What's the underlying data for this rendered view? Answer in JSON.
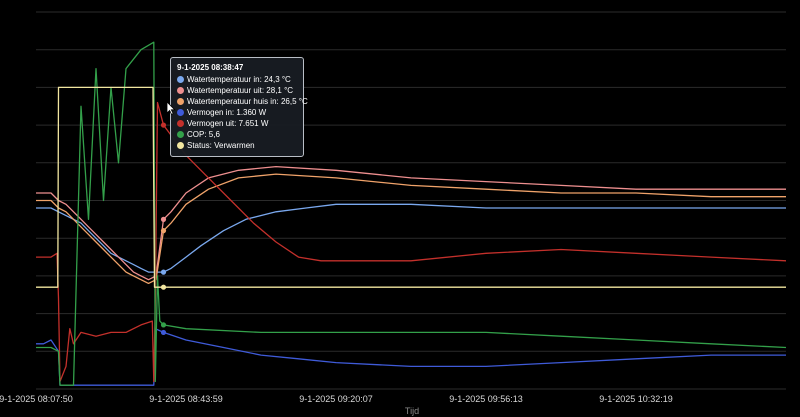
{
  "chart_data": {
    "type": "line",
    "xlabel": "Tijd",
    "x_ticks": [
      "9-1-2025 08:07:50",
      "9-1-2025 08:43:59",
      "9-1-2025 09:20:07",
      "9-1-2025 09:56:13",
      "9-1-2025 10:32:19"
    ],
    "x_range": [
      "9-1-2025 08:07:50",
      "9-1-2025 11:18:00"
    ],
    "y_range": [
      0,
      100
    ],
    "grid": "horizontal",
    "series": [
      {
        "name": "Watertemperatuur in",
        "color": "#7aa8ee",
        "points": [
          [
            0,
            48
          ],
          [
            1,
            48
          ],
          [
            2,
            48
          ],
          [
            3,
            47
          ],
          [
            4,
            46
          ],
          [
            5,
            45
          ],
          [
            6,
            44
          ],
          [
            7,
            42
          ],
          [
            8,
            40
          ],
          [
            9,
            38
          ],
          [
            10,
            36
          ],
          [
            11,
            35
          ],
          [
            12,
            34
          ],
          [
            13,
            33
          ],
          [
            14,
            32
          ],
          [
            15,
            31
          ],
          [
            16,
            31
          ],
          [
            17,
            31
          ],
          [
            18,
            32
          ],
          [
            20,
            35
          ],
          [
            22,
            38
          ],
          [
            25,
            42
          ],
          [
            28,
            45
          ],
          [
            32,
            47
          ],
          [
            36,
            48
          ],
          [
            40,
            49
          ],
          [
            45,
            49
          ],
          [
            50,
            49
          ],
          [
            60,
            48
          ],
          [
            70,
            48
          ],
          [
            80,
            48
          ],
          [
            90,
            48
          ],
          [
            100,
            48
          ]
        ]
      },
      {
        "name": "Watertemperatuur uit",
        "color": "#ee8f8f",
        "points": [
          [
            0,
            52
          ],
          [
            1,
            52
          ],
          [
            2,
            52
          ],
          [
            3,
            50
          ],
          [
            4,
            49
          ],
          [
            5,
            47
          ],
          [
            6,
            45
          ],
          [
            7,
            43
          ],
          [
            8,
            41
          ],
          [
            9,
            39
          ],
          [
            10,
            37
          ],
          [
            11,
            35
          ],
          [
            12,
            33
          ],
          [
            13,
            31
          ],
          [
            14,
            30
          ],
          [
            15,
            29
          ],
          [
            16,
            30
          ],
          [
            17,
            45
          ],
          [
            18,
            47
          ],
          [
            20,
            52
          ],
          [
            23,
            56
          ],
          [
            27,
            58
          ],
          [
            32,
            59
          ],
          [
            40,
            58
          ],
          [
            50,
            56
          ],
          [
            60,
            55
          ],
          [
            70,
            54
          ],
          [
            80,
            53
          ],
          [
            90,
            53
          ],
          [
            100,
            53
          ]
        ]
      },
      {
        "name": "Watertemperatuur huis in",
        "color": "#f0a36a",
        "points": [
          [
            0,
            50
          ],
          [
            1,
            50
          ],
          [
            2,
            50
          ],
          [
            3,
            48
          ],
          [
            4,
            47
          ],
          [
            5,
            45
          ],
          [
            6,
            43
          ],
          [
            7,
            41
          ],
          [
            8,
            39
          ],
          [
            9,
            37
          ],
          [
            10,
            35
          ],
          [
            11,
            33
          ],
          [
            12,
            31
          ],
          [
            13,
            30
          ],
          [
            14,
            29
          ],
          [
            15,
            28
          ],
          [
            16,
            29
          ],
          [
            17,
            42
          ],
          [
            18,
            44
          ],
          [
            20,
            49
          ],
          [
            23,
            53
          ],
          [
            27,
            56
          ],
          [
            32,
            57
          ],
          [
            40,
            56
          ],
          [
            50,
            54
          ],
          [
            60,
            53
          ],
          [
            70,
            52
          ],
          [
            80,
            52
          ],
          [
            90,
            51
          ],
          [
            100,
            51
          ]
        ]
      },
      {
        "name": "Vermogen in",
        "color": "#3f5bd9",
        "points": [
          [
            0,
            12
          ],
          [
            1,
            12
          ],
          [
            2,
            13
          ],
          [
            3,
            10
          ],
          [
            3.2,
            1
          ],
          [
            5,
            1
          ],
          [
            6,
            1
          ],
          [
            8,
            1
          ],
          [
            10,
            1
          ],
          [
            12,
            1
          ],
          [
            14,
            1
          ],
          [
            15.7,
            1
          ],
          [
            15.9,
            16
          ],
          [
            17,
            15
          ],
          [
            20,
            13
          ],
          [
            25,
            11
          ],
          [
            30,
            9
          ],
          [
            35,
            8
          ],
          [
            40,
            7
          ],
          [
            50,
            6
          ],
          [
            60,
            6
          ],
          [
            70,
            7
          ],
          [
            80,
            8
          ],
          [
            90,
            9
          ],
          [
            100,
            9
          ]
        ]
      },
      {
        "name": "Vermogen uit",
        "color": "#c3302b",
        "points": [
          [
            0,
            35
          ],
          [
            2,
            35
          ],
          [
            2.8,
            36
          ],
          [
            3,
            24
          ],
          [
            3.2,
            2
          ],
          [
            4,
            6
          ],
          [
            4.5,
            16
          ],
          [
            5,
            12
          ],
          [
            6,
            15
          ],
          [
            8,
            14
          ],
          [
            10,
            15
          ],
          [
            12,
            15
          ],
          [
            14,
            17
          ],
          [
            15.5,
            18
          ],
          [
            15.7,
            2
          ],
          [
            15.9,
            23
          ],
          [
            16.2,
            76
          ],
          [
            17,
            70
          ],
          [
            20,
            62
          ],
          [
            23,
            56
          ],
          [
            26,
            50
          ],
          [
            29,
            44
          ],
          [
            32,
            39
          ],
          [
            35,
            35
          ],
          [
            38,
            34
          ],
          [
            40,
            34
          ],
          [
            50,
            34
          ],
          [
            60,
            36
          ],
          [
            70,
            37
          ],
          [
            80,
            36
          ],
          [
            90,
            35
          ],
          [
            100,
            34
          ]
        ]
      },
      {
        "name": "COP",
        "color": "#33a04a",
        "points": [
          [
            0,
            11
          ],
          [
            2,
            11
          ],
          [
            3,
            10
          ],
          [
            3.2,
            1
          ],
          [
            5,
            1
          ],
          [
            6,
            75
          ],
          [
            7,
            45
          ],
          [
            8,
            85
          ],
          [
            9,
            50
          ],
          [
            10,
            80
          ],
          [
            11,
            60
          ],
          [
            12,
            85
          ],
          [
            14,
            90
          ],
          [
            15.7,
            92
          ],
          [
            15.9,
            2
          ],
          [
            16.2,
            30
          ],
          [
            16.5,
            18
          ],
          [
            17,
            17
          ],
          [
            20,
            16
          ],
          [
            30,
            15
          ],
          [
            40,
            15
          ],
          [
            50,
            15
          ],
          [
            60,
            15
          ],
          [
            70,
            14
          ],
          [
            80,
            13
          ],
          [
            90,
            12
          ],
          [
            100,
            11
          ]
        ]
      },
      {
        "name": "Status",
        "color": "#f2e6a0",
        "points": [
          [
            0,
            27
          ],
          [
            2.9,
            27
          ],
          [
            3,
            80
          ],
          [
            15.6,
            80
          ],
          [
            15.8,
            27
          ],
          [
            100,
            27
          ]
        ]
      }
    ],
    "tooltip": {
      "title": "9-1-2025 08:38:47",
      "rows": [
        {
          "label": "Watertemperatuur in: 24,3 °C",
          "color": "#7aa8ee"
        },
        {
          "label": "Watertemperatuur uit: 28,1 °C",
          "color": "#ee8f8f"
        },
        {
          "label": "Watertemperatuur huis in: 26,5 °C",
          "color": "#f0a36a"
        },
        {
          "label": "Vermogen in: 1.360 W",
          "color": "#3f5bd9"
        },
        {
          "label": "Vermogen uit: 7.651 W",
          "color": "#c3302b"
        },
        {
          "label": "COP: 5,6",
          "color": "#33a04a"
        },
        {
          "label": "Status: Verwarmen",
          "color": "#f2e6a0"
        }
      ]
    }
  }
}
